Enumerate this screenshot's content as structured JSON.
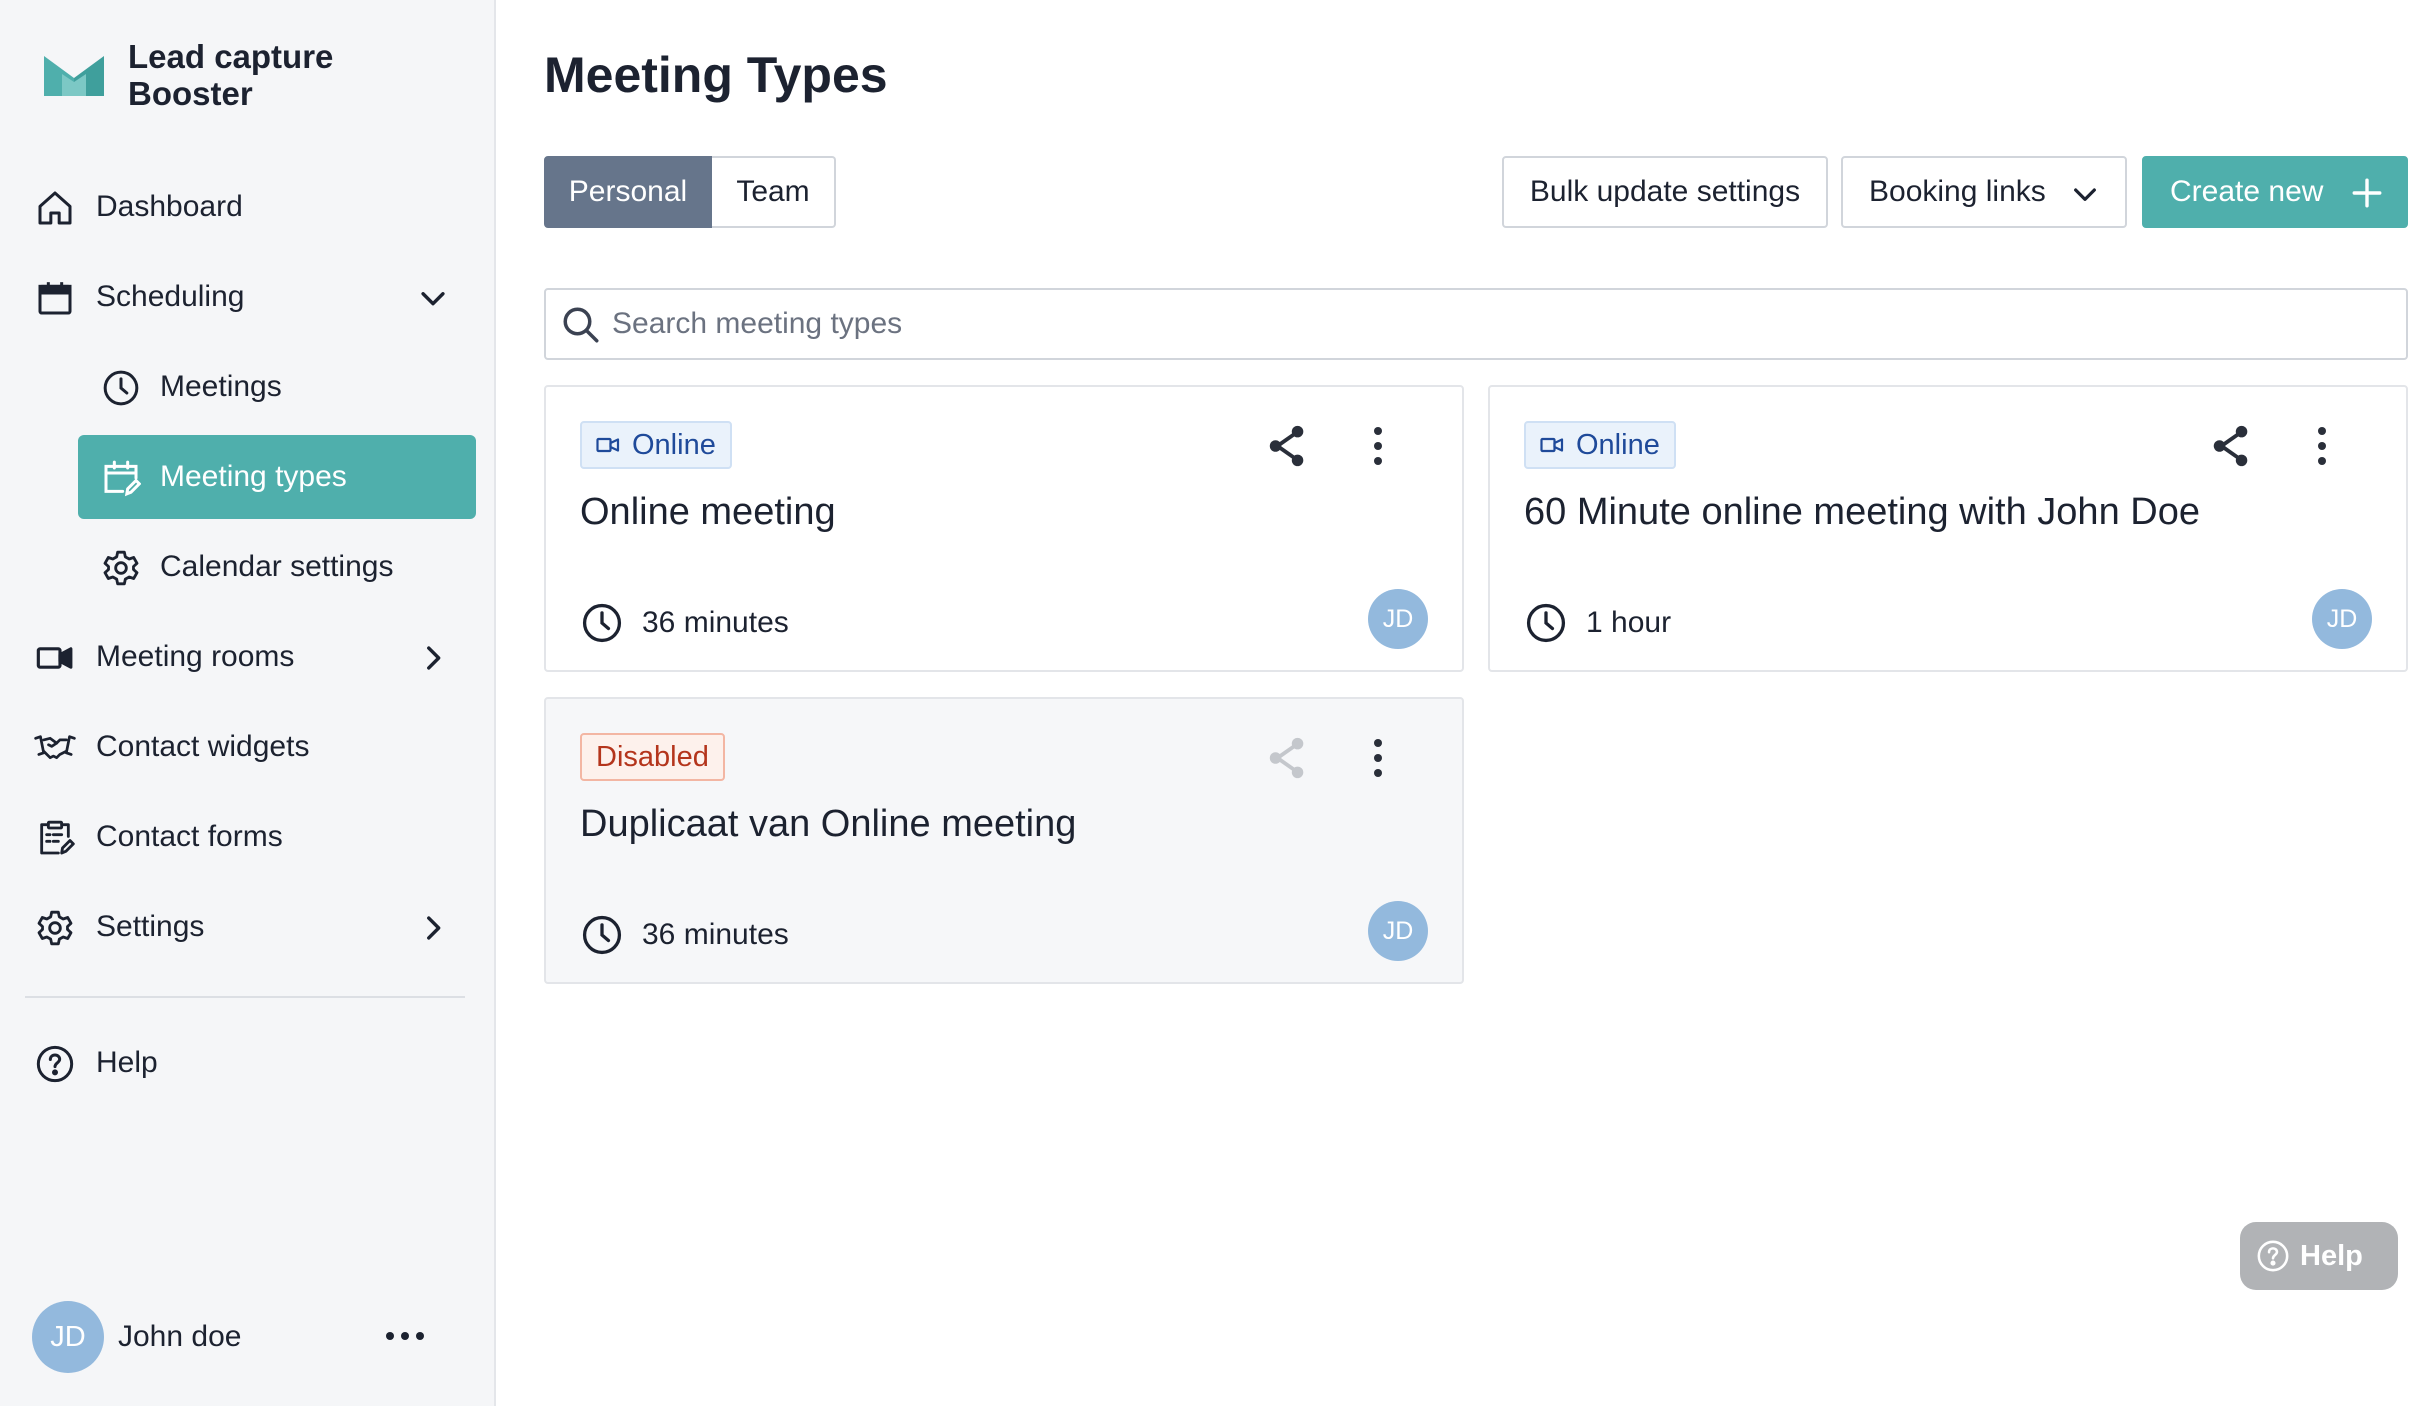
{
  "brand": {
    "name": "Lead capture Booster",
    "logo_color": "#4fafac"
  },
  "sidebar": {
    "items": [
      {
        "label": "Dashboard",
        "icon": "home-icon"
      },
      {
        "label": "Scheduling",
        "icon": "calendar-icon",
        "expanded": true
      },
      {
        "label": "Meetings",
        "icon": "clock-icon",
        "sub": true
      },
      {
        "label": "Meeting types",
        "icon": "calendar-edit-icon",
        "sub": true,
        "active": true
      },
      {
        "label": "Calendar settings",
        "icon": "gear-icon",
        "sub": true
      },
      {
        "label": "Meeting rooms",
        "icon": "video-icon"
      },
      {
        "label": "Contact widgets",
        "icon": "handshake-icon"
      },
      {
        "label": "Contact forms",
        "icon": "form-icon"
      },
      {
        "label": "Settings",
        "icon": "gear-icon"
      }
    ],
    "help_label": "Help",
    "user": {
      "initials": "JD",
      "name": "John doe"
    }
  },
  "header": {
    "title": "Meeting Types",
    "tabs": [
      {
        "label": "Personal",
        "active": true
      },
      {
        "label": "Team",
        "active": false
      }
    ],
    "bulk_label": "Bulk update settings",
    "links_label": "Booking links",
    "create_label": "Create new"
  },
  "search": {
    "placeholder": "Search meeting types",
    "value": ""
  },
  "cards": [
    {
      "badge": "Online",
      "title": "Online meeting",
      "duration": "36 minutes",
      "owner": "JD",
      "status": "online"
    },
    {
      "badge": "Online",
      "title": "60 Minute online meeting with John Doe",
      "duration": "1 hour",
      "owner": "JD",
      "status": "online"
    },
    {
      "badge": "Disabled",
      "title": "Duplicaat van Online meeting",
      "duration": "36 minutes",
      "owner": "JD",
      "status": "disabled"
    }
  ],
  "help_widget": {
    "label": "Help"
  },
  "colors": {
    "accent": "#4fafac",
    "segment_active": "#66758b",
    "avatar": "#93b9dd",
    "online_text": "#1f4a9a",
    "disabled_text": "#b4351c"
  }
}
